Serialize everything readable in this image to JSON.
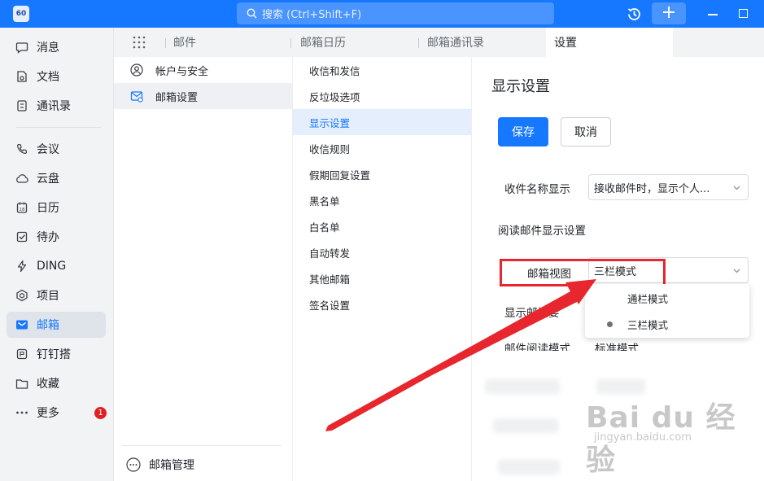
{
  "titlebar": {
    "avatar_text": "60",
    "search_placeholder": "搜索 (Ctrl+Shift+F)"
  },
  "nav": {
    "items": [
      {
        "label": "消息",
        "icon": "chat-icon"
      },
      {
        "label": "文档",
        "icon": "document-icon"
      },
      {
        "label": "通讯录",
        "icon": "contacts-icon"
      },
      {
        "label": "会议",
        "icon": "phone-icon"
      },
      {
        "label": "云盘",
        "icon": "cloud-icon"
      },
      {
        "label": "日历",
        "icon": "calendar-icon"
      },
      {
        "label": "待办",
        "icon": "checkbox-icon"
      },
      {
        "label": "DING",
        "icon": "lightning-icon"
      },
      {
        "label": "项目",
        "icon": "hexagon-icon"
      },
      {
        "label": "邮箱",
        "icon": "mail-icon"
      },
      {
        "label": "钉钉搭",
        "icon": "build-icon"
      },
      {
        "label": "收藏",
        "icon": "folder-icon"
      },
      {
        "label": "更多",
        "icon": "more-icon"
      }
    ],
    "more_badge": "1",
    "active": "邮箱"
  },
  "tabs": [
    {
      "label": "邮件"
    },
    {
      "label": "邮箱日历"
    },
    {
      "label": "邮箱通讯录"
    },
    {
      "label": "设置"
    }
  ],
  "accounts": {
    "items": [
      {
        "label": "帐户与安全",
        "icon": "user-icon"
      },
      {
        "label": "邮箱设置",
        "icon": "mail-settings-icon"
      }
    ],
    "manage_label": "邮箱管理"
  },
  "settings_menu": {
    "items": [
      "收信和发信",
      "反垃圾选项",
      "显示设置",
      "收信规则",
      "假期回复设置",
      "黑名单",
      "白名单",
      "自动转发",
      "其他邮箱",
      "签名设置"
    ],
    "active": "显示设置"
  },
  "display": {
    "title": "显示设置",
    "save_label": "保存",
    "cancel_label": "取消",
    "sender_name_label": "收件名称显示",
    "sender_name_value": "接收邮件时，显示个人...",
    "read_section_label": "阅读邮件显示设置",
    "mailbox_view_label": "邮箱视图",
    "mailbox_view_value": "三栏模式",
    "view_options": [
      {
        "label": "通栏模式",
        "selected": false
      },
      {
        "label": "三栏模式",
        "selected": true
      }
    ],
    "summary_label_partial": "显示邮",
    "summary_label_tail": "摘要",
    "read_mode_label": "邮件阅读模式",
    "read_mode_value": "标准模式"
  },
  "watermark": {
    "main": "Bai du 经验",
    "sub": "jingyan.baidu.com"
  },
  "colors": {
    "accent": "#1677ff",
    "annotation": "#e8262d",
    "badge": "#e02020"
  }
}
